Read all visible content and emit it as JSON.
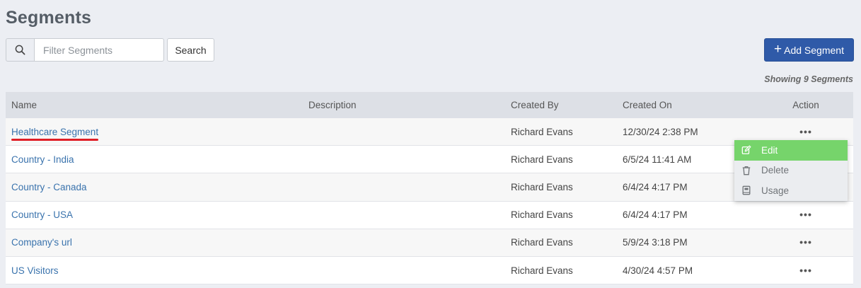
{
  "page_title": "Segments",
  "search": {
    "placeholder": "Filter Segments",
    "value": "",
    "button_label": "Search"
  },
  "add_button_label": "Add Segment",
  "count_text": "Showing 9 Segments",
  "table": {
    "headers": {
      "name": "Name",
      "description": "Description",
      "created_by": "Created By",
      "created_on": "Created On",
      "action": "Action"
    },
    "rows": [
      {
        "name": "Healthcare Segment",
        "description": "",
        "created_by": "Richard Evans",
        "created_on": "12/30/24 2:38 PM"
      },
      {
        "name": "Country - India",
        "description": "",
        "created_by": "Richard Evans",
        "created_on": "6/5/24 11:41 AM"
      },
      {
        "name": "Country - Canada",
        "description": "",
        "created_by": "Richard Evans",
        "created_on": "6/4/24 4:17 PM"
      },
      {
        "name": "Country - USA",
        "description": "",
        "created_by": "Richard Evans",
        "created_on": "6/4/24 4:17 PM"
      },
      {
        "name": "Company's url",
        "description": "",
        "created_by": "Richard Evans",
        "created_on": "5/9/24 3:18 PM"
      },
      {
        "name": "US Visitors",
        "description": "",
        "created_by": "Richard Evans",
        "created_on": "4/30/24 4:57 PM"
      }
    ],
    "action_glyph": "•••"
  },
  "action_menu": {
    "items": [
      {
        "label": "Edit",
        "icon": "edit-icon"
      },
      {
        "label": "Delete",
        "icon": "trash-icon"
      },
      {
        "label": "Usage",
        "icon": "book-icon"
      }
    ]
  },
  "colors": {
    "primary": "#2f5aa8",
    "link": "#3a73ad",
    "menu_highlight": "#76d46b",
    "annotation": "#e01e26"
  }
}
